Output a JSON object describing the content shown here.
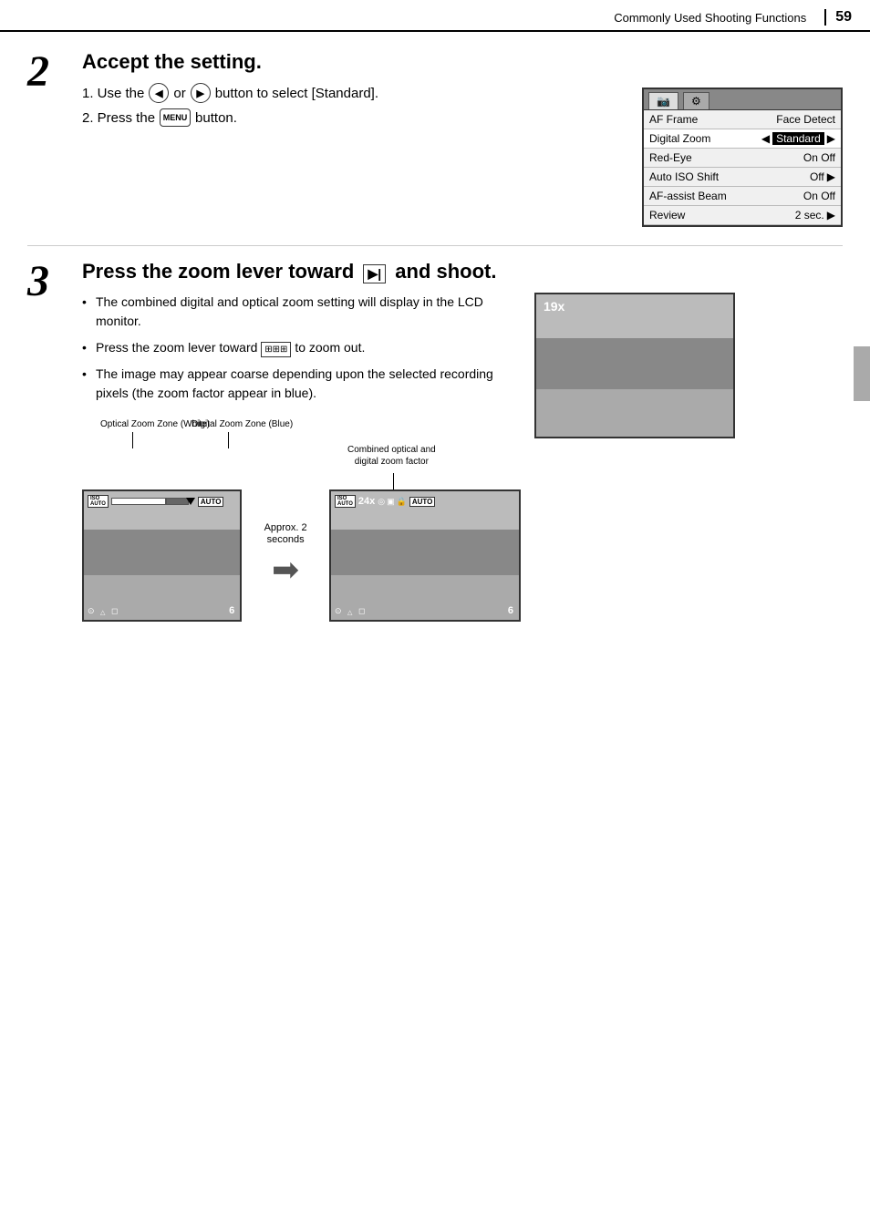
{
  "header": {
    "title": "Commonly Used Shooting Functions",
    "page_number": "59"
  },
  "step2": {
    "number": "2",
    "title": "Accept the setting.",
    "instruction1_prefix": "1. Use the",
    "instruction1_middle": "or",
    "instruction1_suffix": "button to select [Standard].",
    "instruction2_prefix": "2. Press the",
    "instruction2_suffix": "button.",
    "menu": {
      "tabs": [
        "camera-icon",
        "settings-icon"
      ],
      "rows": [
        {
          "label": "AF Frame",
          "value": "Face Detect",
          "highlighted": false
        },
        {
          "label": "Digital Zoom",
          "value": "Standard",
          "highlighted": true
        },
        {
          "label": "Red-Eye",
          "value": "On Off",
          "highlighted": false
        },
        {
          "label": "Auto ISO Shift",
          "value": "Off",
          "highlighted": false
        },
        {
          "label": "AF-assist Beam",
          "value": "On Off",
          "highlighted": false
        },
        {
          "label": "Review",
          "value": "2 sec.",
          "highlighted": false
        }
      ]
    }
  },
  "step3": {
    "number": "3",
    "title": "Press the zoom lever toward",
    "title_suffix": "and shoot.",
    "zoom_icon": "▶",
    "bullets": [
      "The combined digital and optical zoom setting will display in the LCD monitor.",
      "Press the zoom lever toward",
      "to zoom out.",
      "The image may appear coarse depending upon the selected recording pixels (the zoom factor appear in blue)."
    ],
    "bullet2_icon": "⊞⊞⊞",
    "bullet2_suffix": "to zoom out.",
    "zoom_preview": {
      "overlay_text": "19x"
    },
    "diagram_left": {
      "optical_label": "Optical Zoom Zone (White)",
      "digital_label": "Digital Zoom Zone (Blue)",
      "iso_text": "ISO AUTO",
      "auto_text": "AUTO"
    },
    "arrow_label": "Approx. 2 seconds",
    "diagram_right": {
      "combined_label_line1": "Combined optical and",
      "combined_label_line2": "digital zoom factor",
      "zoom_value": "24x",
      "auto_text": "AUTO"
    }
  }
}
